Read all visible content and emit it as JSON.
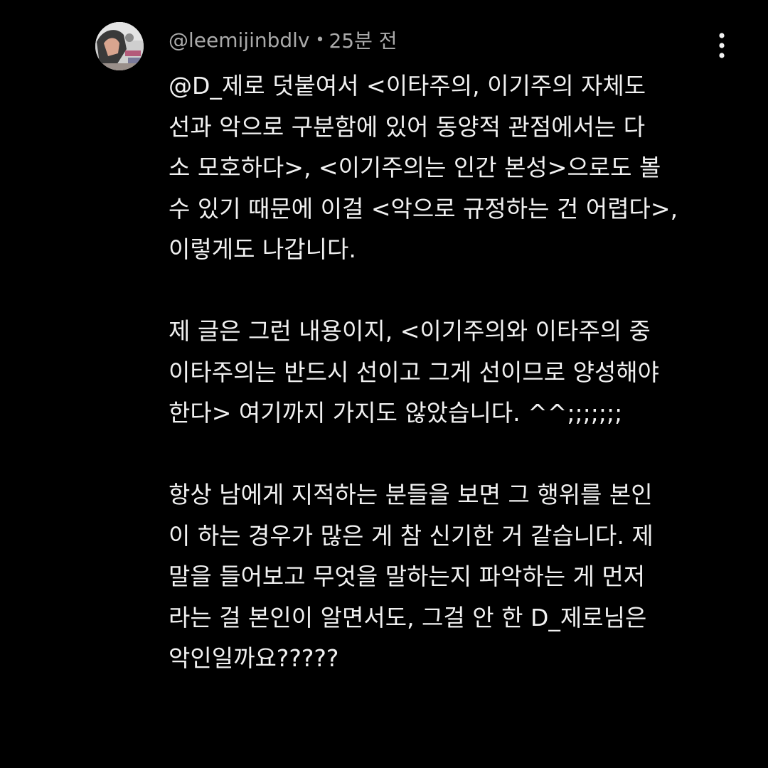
{
  "comment": {
    "author_handle": "@leemijinbdlv",
    "separator": "•",
    "time_ago": "25분 전",
    "more_icon": "more-vert-icon",
    "avatar_icon": "avatar",
    "paragraphs": [
      [
        "@D_제로 덧붙여서 <이타주의, 이기주의 자체도",
        "선과 악으로 구분함에 있어 동양적 관점에서는 다",
        "소 모호하다>, <이기주의는 인간 본성>으로도 볼",
        "수 있기 때문에 이걸 <악으로 규정하는 건 어렵다>,",
        "이렇게도 나갑니다."
      ],
      [
        "제 글은 그런 내용이지, <이기주의와 이타주의 중",
        "이타주의는 반드시 선이고 그게 선이므로 양성해야",
        "한다> 여기까지 가지도 않았습니다. ^^;;;;;;;"
      ],
      [
        "항상 남에게 지적하는 분들을 보면 그 행위를 본인",
        "이 하는 경우가 많은 게 참 신기한 거 같습니다. 제",
        "말을 들어보고 무엇을 말하는지 파악하는 게 먼저",
        "라는 걸 본인이 알면서도, 그걸 안 한 D_제로님은",
        "악인일까요?????"
      ]
    ]
  },
  "colors": {
    "background": "#000000",
    "text_primary": "#f1f1f1",
    "text_secondary": "#aaaaaa"
  }
}
